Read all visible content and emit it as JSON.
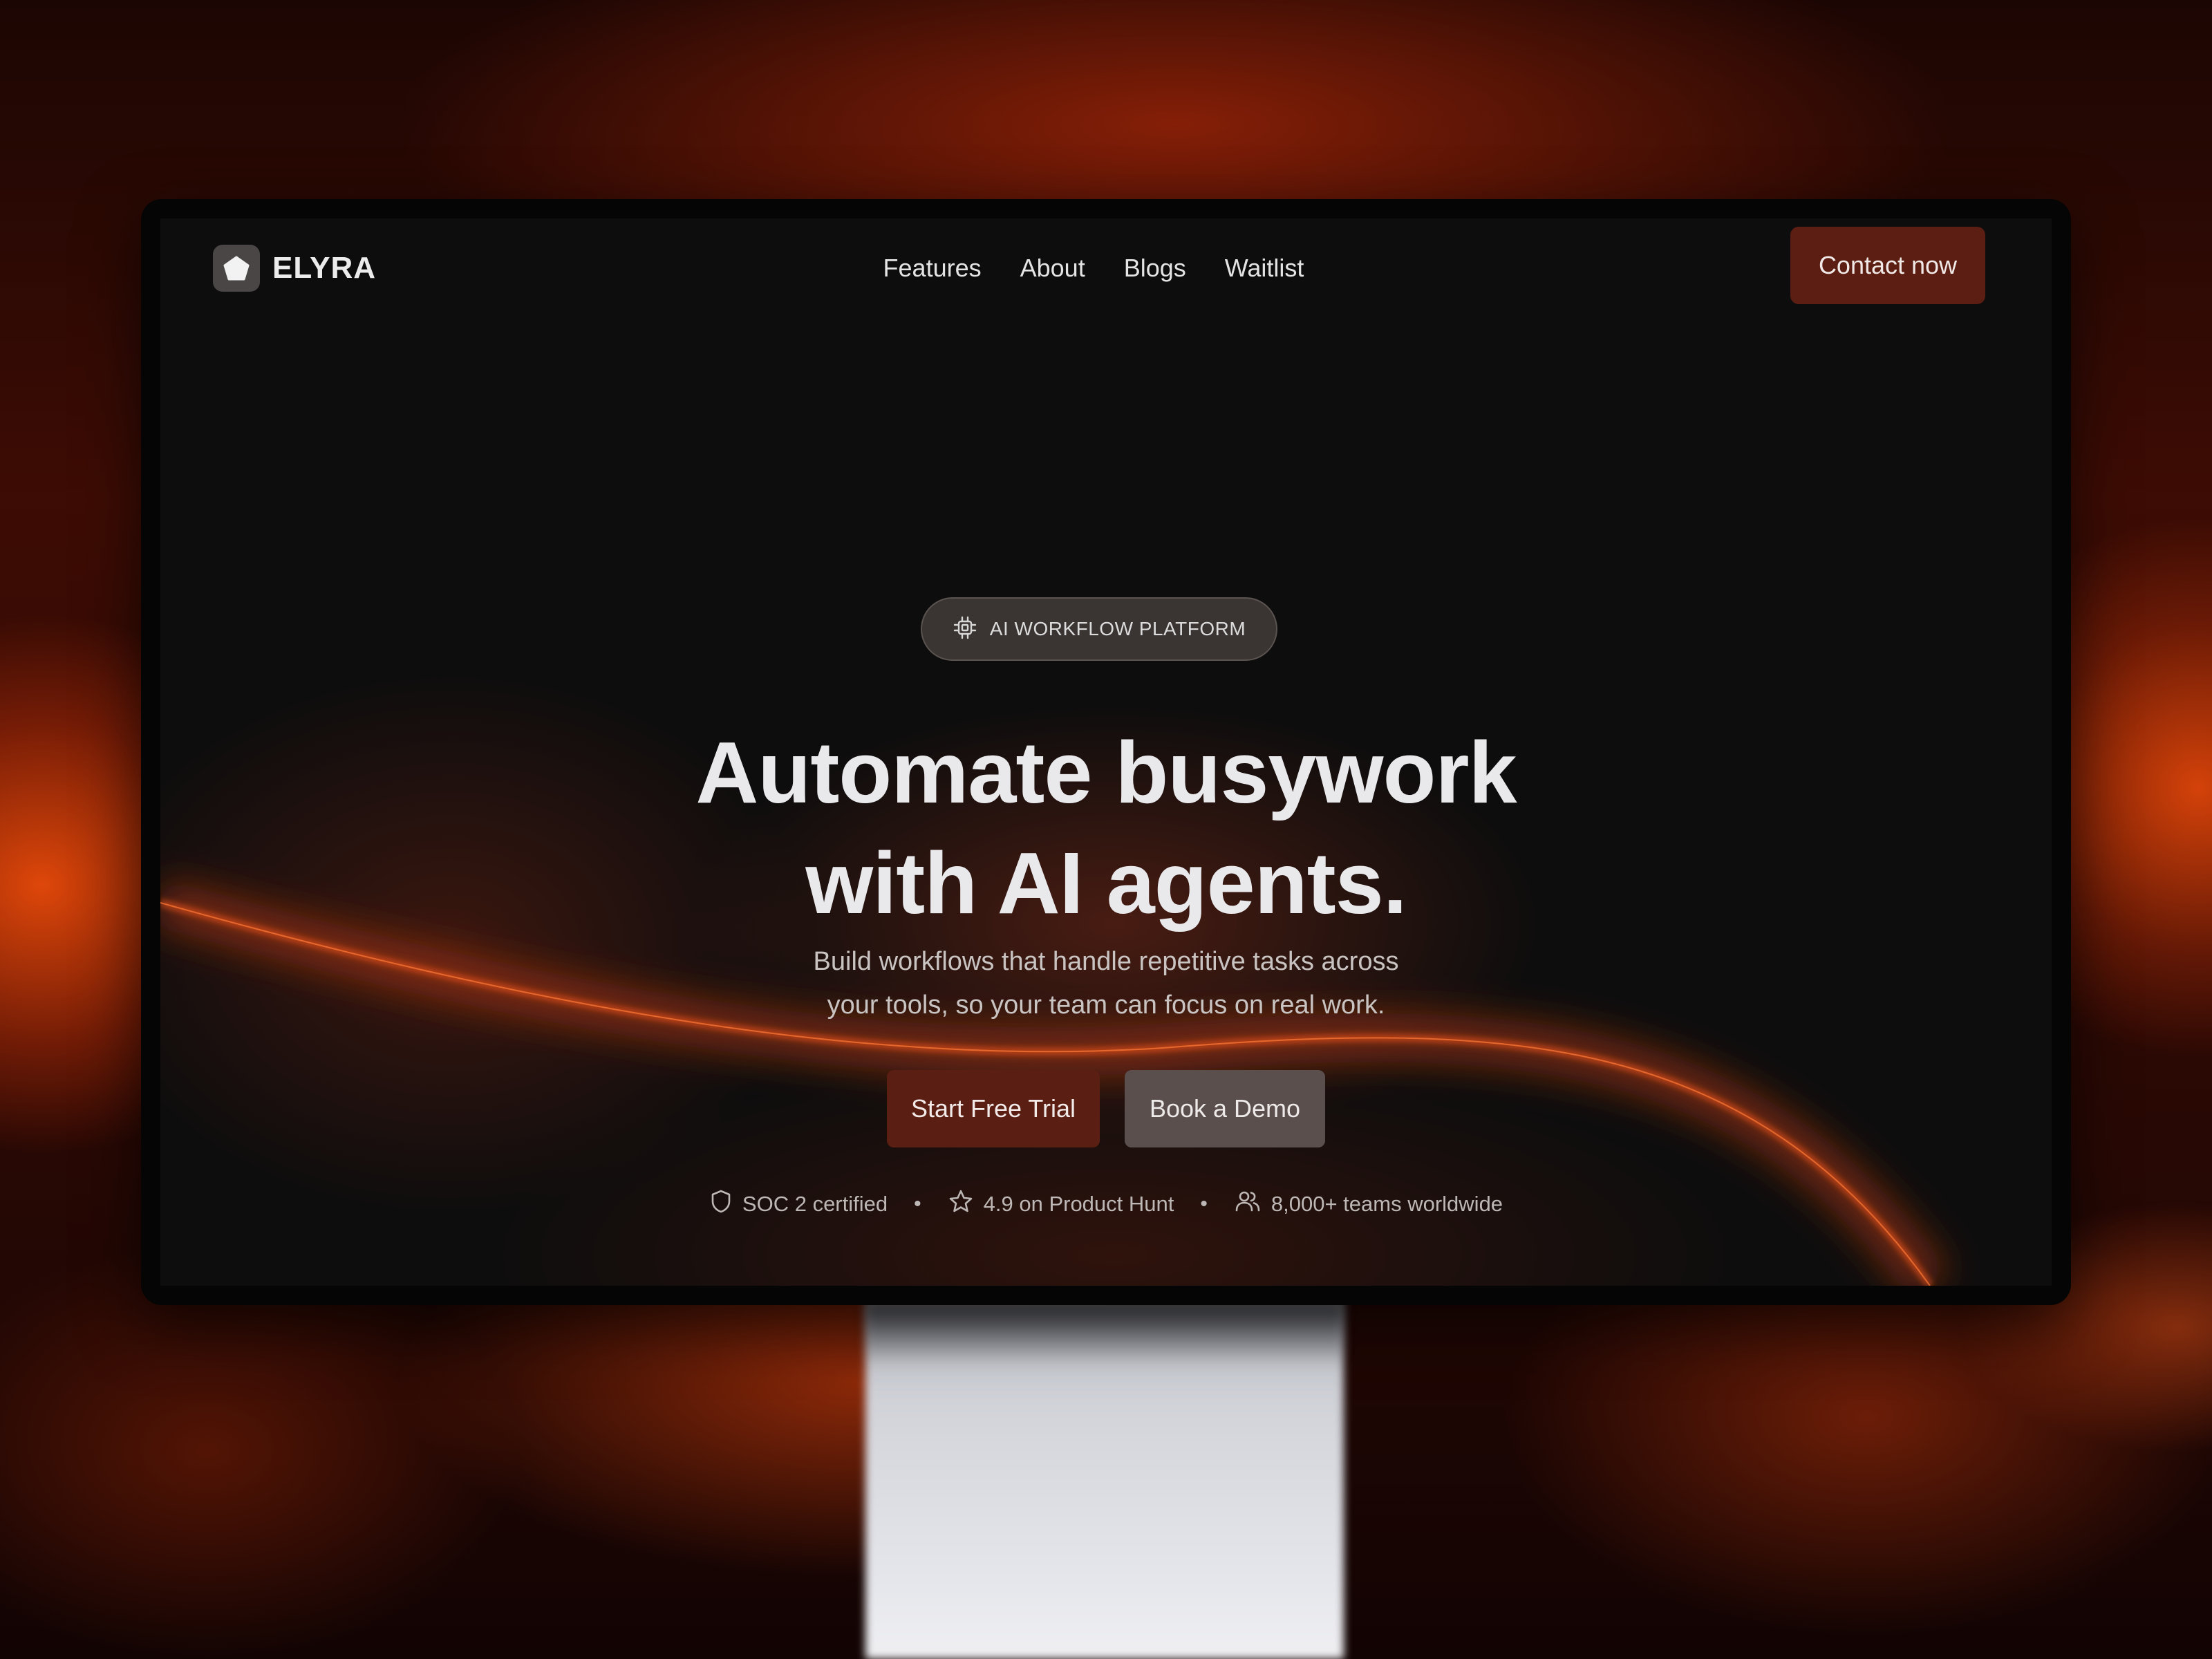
{
  "brand": {
    "name": "ELYRA",
    "icon": "pentagon-logo-icon"
  },
  "nav": {
    "links": [
      {
        "label": "Features"
      },
      {
        "label": "About"
      },
      {
        "label": "Blogs"
      },
      {
        "label": "Waitlist"
      }
    ],
    "cta_label": "Contact now"
  },
  "hero": {
    "badge": {
      "icon": "chip-icon",
      "label": "AI WORKFLOW PLATFORM"
    },
    "headline": [
      "Automate busywork",
      "with AI agents."
    ],
    "subtext": [
      "Build workflows that handle repetitive tasks across",
      "your tools, so your team can focus on real work."
    ],
    "primary_cta": "Start Free Trial",
    "secondary_cta": "Book a Demo"
  },
  "trust": [
    {
      "icon": "shield-icon",
      "label": "SOC 2 certified"
    },
    {
      "icon": "star-icon",
      "label": "4.9 on Product Hunt"
    },
    {
      "icon": "users-icon",
      "label": "8,000+ teams worldwide"
    }
  ],
  "separator": "•",
  "colors": {
    "accent": "#5a1e12",
    "background": "#0e0d0d",
    "glow": "#e8440f"
  }
}
